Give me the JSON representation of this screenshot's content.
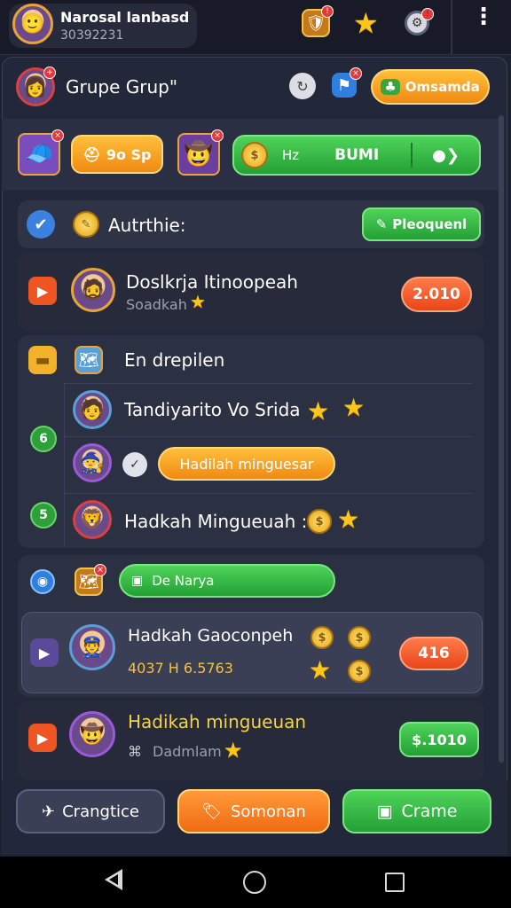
{
  "header": {
    "player_name": "Narosal lanbasd",
    "player_id": "30392231"
  },
  "group": {
    "title": "Grupe Grup\"",
    "action_label": "Omsamda"
  },
  "row2": {
    "chip_label": "9o Sp",
    "bar_left": "Hz",
    "bar_mid": "BUMI"
  },
  "section1": {
    "label": "Autrthie:",
    "button_label": "Pleoquenl"
  },
  "item1": {
    "title": "Doslkrja Itinoopeah",
    "subtitle": "Soadkah",
    "value": "2.010"
  },
  "section2": {
    "label": "En drepilen",
    "row1_title": "Tandiyarito Vo Srida",
    "row2_button": "Hadilah minguesar",
    "row3_title": "Hadkah Mingueuah :",
    "side_badge1": "6",
    "side_badge2": "5"
  },
  "section3": {
    "button_label": "De Narya",
    "item_title": "Hadkah Gaoconpeh",
    "item_stats": "4037 H 6.5763",
    "item_value": "416",
    "item2_title": "Hadikah mingueuan",
    "item2_sub": "Dadmlam",
    "item2_value": "$.1010"
  },
  "footer": {
    "left_label": "Crangtice",
    "mid_label": "Somonan",
    "right_label": "Crame"
  },
  "colors": {
    "accent_orange": "#f08a12",
    "accent_green": "#23a035",
    "accent_red": "#e84618",
    "panel": "#2e3345"
  }
}
